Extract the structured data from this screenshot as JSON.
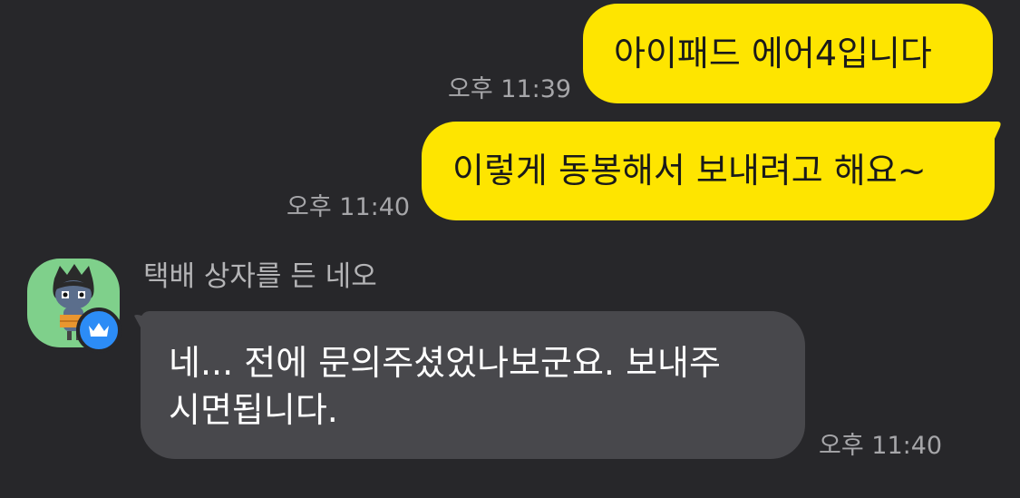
{
  "messages": [
    {
      "direction": "out",
      "text": "아이패드 에어4입니다",
      "time": "오후 11:39"
    },
    {
      "direction": "out",
      "text": "이렇게 동봉해서 보내려고 해요~",
      "time": "오후 11:40"
    },
    {
      "direction": "in",
      "sender": "택배 상자를 든 네오",
      "text_line1": "네... 전에 문의주셨었나보군요. 보내주",
      "text_line2": "시면됩니다.",
      "time": "오후 11:40"
    }
  ],
  "colors": {
    "background": "#27272a",
    "outgoing_bubble": "#fee500",
    "incoming_bubble": "#48484c",
    "badge": "#2c8cf6"
  },
  "icons": {
    "avatar": "neo-character-avatar",
    "badge": "crown-icon"
  }
}
